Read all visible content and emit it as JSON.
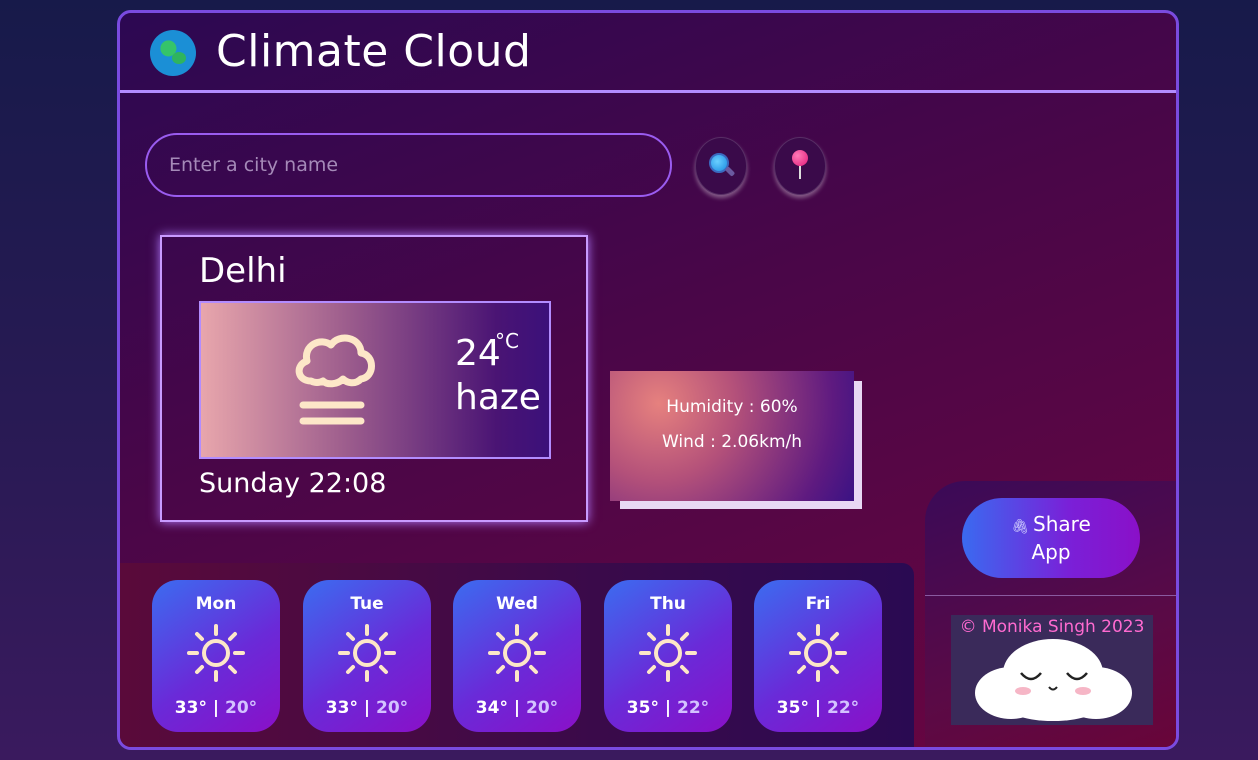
{
  "app": {
    "title": "Climate Cloud"
  },
  "search": {
    "placeholder": "Enter a city name",
    "value": ""
  },
  "icons": {
    "logo": "globe-icon",
    "search": "magnifier-icon",
    "location": "pushpin-icon",
    "share": "paperclip-icon"
  },
  "current": {
    "city": "Delhi",
    "temperature": "24",
    "unit": "°C",
    "condition": "haze",
    "icon": "haze-icon",
    "datetime": "Sunday 22:08"
  },
  "details": {
    "humidity": "Humidity : 60%",
    "wind": "Wind : 2.06km/h"
  },
  "forecast": [
    {
      "day": "Mon",
      "high": "33°",
      "low": "20°",
      "icon": "sun-icon"
    },
    {
      "day": "Tue",
      "high": "33°",
      "low": "20°",
      "icon": "sun-icon"
    },
    {
      "day": "Wed",
      "high": "34°",
      "low": "20°",
      "icon": "sun-icon"
    },
    {
      "day": "Thu",
      "high": "35°",
      "low": "22°",
      "icon": "sun-icon"
    },
    {
      "day": "Fri",
      "high": "35°",
      "low": "22°",
      "icon": "sun-icon"
    }
  ],
  "forecast_separator": " | ",
  "share": {
    "label_line1": "Share",
    "label_line2": "App"
  },
  "footer": {
    "copyright": "© Monika Singh 2023"
  },
  "colors": {
    "accent": "#7a4be0",
    "border_light": "#b28cff",
    "card_gradient_start": "#3b6cf0",
    "card_gradient_end": "#8a10c8",
    "copyright": "#ff6ad0"
  }
}
